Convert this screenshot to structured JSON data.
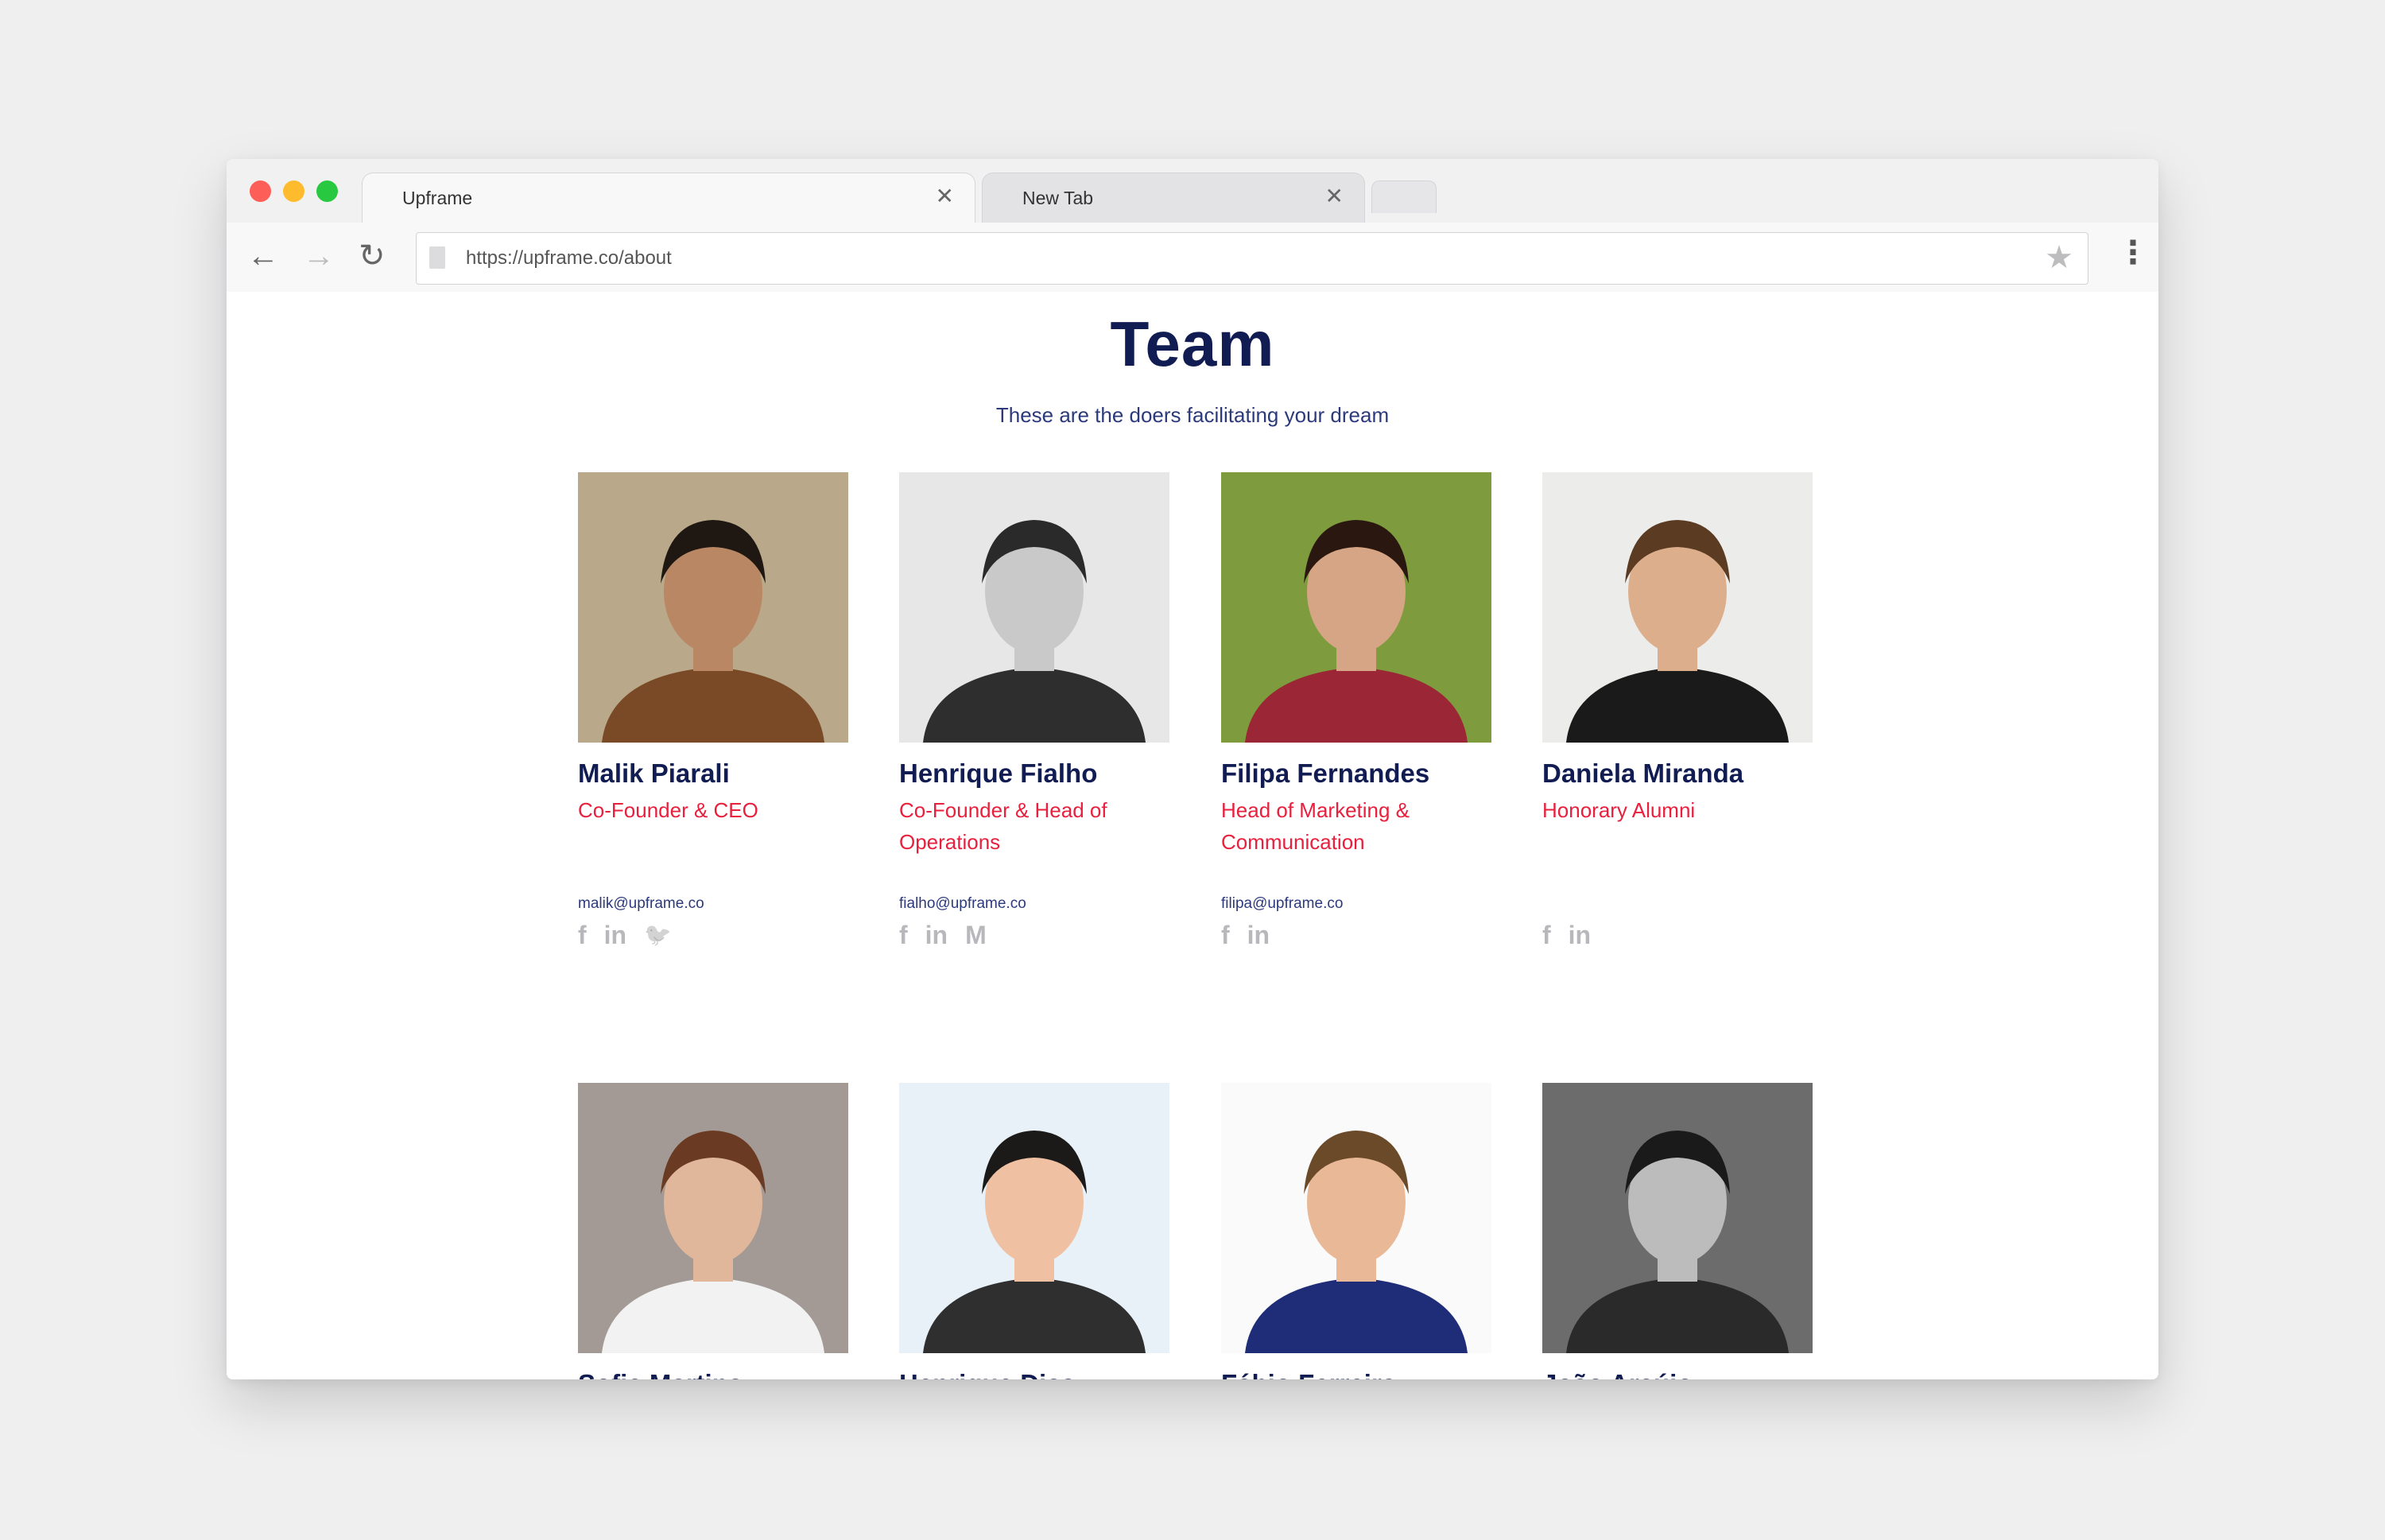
{
  "browser": {
    "tabs": [
      {
        "title": "Upframe",
        "close": "✕"
      },
      {
        "title": "New Tab",
        "close": "✕"
      }
    ],
    "url": "https://upframe.co/about",
    "back_icon": "←",
    "forward_icon": "→",
    "reload_icon": "↻",
    "star_icon": "★",
    "menu_icon": "⋮"
  },
  "page": {
    "title": "Team",
    "subtitle": "These are the doers facilitating your dream"
  },
  "social_glyphs": {
    "facebook": "f",
    "linkedin": "in",
    "twitter": "🐦",
    "medium": "M"
  },
  "team": [
    {
      "name": "Malik Piarali",
      "role": "Co-Founder & CEO",
      "email": "malik@upframe.co",
      "bg": "#b9a98a",
      "skin": "#b98763",
      "hair": "#1e1712",
      "shirt": "#7a4a27"
    },
    {
      "name": "Henrique Fialho",
      "role": "Co-Founder & Head of Operations",
      "email": "fialho@upframe.co",
      "bg": "#e7e7e7",
      "skin": "#c9c9c9",
      "hair": "#2a2a2a",
      "shirt": "#2e2e2e"
    },
    {
      "name": "Filipa Fernandes",
      "role": "Head of Marketing & Communication",
      "email": "filipa@upframe.co",
      "bg": "#7e9b3e",
      "skin": "#d6a585",
      "hair": "#2a1810",
      "shirt": "#9a2636"
    },
    {
      "name": "Daniela Miranda",
      "role": "Honorary Alumni",
      "email": "",
      "bg": "#ececea",
      "skin": "#dcae8c",
      "hair": "#5b3b22",
      "shirt": "#1a1a1a"
    },
    {
      "name": "Sofia Martins",
      "role": "",
      "email": "",
      "bg": "#a39a96",
      "skin": "#e0b79a",
      "hair": "#6a3a22",
      "shirt": "#f2f2f2"
    },
    {
      "name": "Henrique Dias",
      "role": "",
      "email": "",
      "bg": "#e8f1f7",
      "skin": "#efc1a2",
      "hair": "#1c1a18",
      "shirt": "#2f2f2f"
    },
    {
      "name": "Fábio Ferreira",
      "role": "",
      "email": "",
      "bg": "#fafafa",
      "skin": "#e9b896",
      "hair": "#6b4a2a",
      "shirt": "#1f2d78"
    },
    {
      "name": "João Araújo",
      "role": "",
      "email": "",
      "bg": "#6c6c6c",
      "skin": "#bcbcbc",
      "hair": "#1a1a1a",
      "shirt": "#2a2a2a"
    }
  ]
}
